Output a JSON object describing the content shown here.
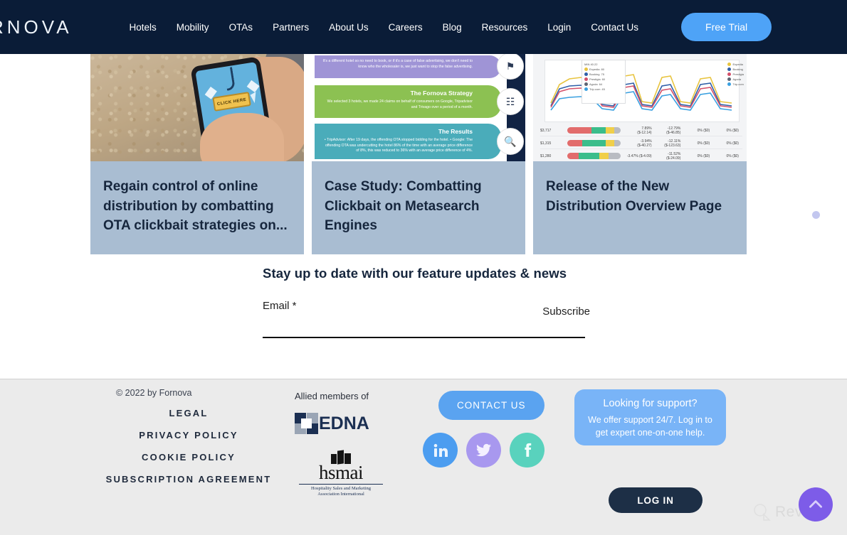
{
  "navbar": {
    "logo": "RNOVA",
    "links": [
      {
        "label": "Hotels"
      },
      {
        "label": "Mobility"
      },
      {
        "label": "OTAs"
      },
      {
        "label": "Partners"
      },
      {
        "label": "About Us"
      },
      {
        "label": "Careers"
      },
      {
        "label": "Blog"
      },
      {
        "label": "Resources"
      },
      {
        "label": "Login"
      },
      {
        "label": "Contact Us"
      }
    ],
    "cta": "Free Trial"
  },
  "cards": [
    {
      "title": "Regain control of online distribution by combatting OTA clickbait strategies on...",
      "image_alt": "hand-holding-phone-clickbait",
      "image_text": "CLICK HERE"
    },
    {
      "title": "Case Study: Combatting Clickbait on Metasearch Engines",
      "image_alt": "fornova-strategy-infographic",
      "bands": [
        {
          "heading": "",
          "body": "It's a different hotel so no need to book, or if it's a case of false advertising, we don't need to know who the wholesaler is, we just want to stop the false advertising.",
          "color": "#9f94d6"
        },
        {
          "heading": "The Fornova Strategy",
          "body": "We selected 3 hotels, we made 24 claims on behalf of consumers on Google, Tripadvisor and Trivago over a period of a month.",
          "color": "#8cc152"
        },
        {
          "heading": "The Results",
          "body": "• TripAdvisor: After 19 days, the offending OTA stopped bidding for the hotel. • Google: The offending OTA was undercutting the hotel 86% of the time with an average price difference of 8%, this was reduced to 36% with an average price difference of 4%.",
          "color": "#4aacba"
        }
      ]
    },
    {
      "title": "Release of the New Distribution Overview Page",
      "image_alt": "distribution-overview-dashboard",
      "chart_legend_title": "MIN 40.22",
      "legend": [
        {
          "name": "Expedia",
          "value": "80",
          "color": "#e8c43f"
        },
        {
          "name": "Booking",
          "value": "75",
          "color": "#2f5fa8"
        },
        {
          "name": "Prestigia",
          "value": "60",
          "color": "#d4516a"
        },
        {
          "name": "Agoda",
          "value": "64",
          "color": "#5d6472"
        },
        {
          "name": "Trip.com",
          "value": "45",
          "color": "#3aa0e0"
        }
      ],
      "rows": [
        {
          "price": "$3,717",
          "pct1": "7.89% ($-12.14)",
          "pct2": "-12.79% ($-46.85)",
          "pct3": "0% ($0)",
          "pct4": "0% ($0)"
        },
        {
          "price": "$1,315",
          "pct1": "-3.94% ($-40.27)",
          "pct2": "-12.11% ($-123.63)",
          "pct3": "0% ($0)",
          "pct4": "0% ($0)"
        },
        {
          "price": "$1,280",
          "pct1": "-3.47% ($-4.09)",
          "pct2": "-11.52% ($-24.09)",
          "pct3": "0% ($0)",
          "pct4": "0% ($0)"
        }
      ]
    }
  ],
  "newsletter": {
    "title": "Stay up to date with our feature updates & news",
    "email_label": "Email *",
    "email_value": "",
    "email_placeholder": "",
    "subscribe_label": "Subscribe"
  },
  "footer": {
    "copyright": "© 2022 by Fornova",
    "links": [
      {
        "label": "LEGAL"
      },
      {
        "label": "PRIVACY POLICY"
      },
      {
        "label": "COOKIE POLICY"
      },
      {
        "label": "SUBSCRIPTION AGREEMENT"
      }
    ],
    "allied_label": "Allied members of",
    "hedna_name": "EDNA",
    "hsmai_name": "hsmai",
    "hsmai_sub_line1": "Hospitality Sales and Marketing",
    "hsmai_sub_line2": "Association International",
    "contact_button": "CONTACT US",
    "social": [
      {
        "name": "linkedin-icon",
        "color": "#4c9df0"
      },
      {
        "name": "twitter-icon",
        "color": "#a898ef"
      },
      {
        "name": "facebook-icon",
        "color": "#59d2bd"
      }
    ],
    "support_title": "Looking for support?",
    "support_body": "We offer support 24/7. Log in to get expert one-on-one help.",
    "login_button": "LOG IN"
  },
  "overlay": {
    "watermark": "Revain"
  },
  "colors": {
    "nav_bg": "#0a1c37",
    "accent_blue": "#4ea3f7",
    "card_caption_bg": "#a9bdd2",
    "footer_bg": "#ebebeb",
    "support_bg": "#79b4f7",
    "login_bg": "#1d2f46",
    "scrolltop_bg": "#7d5ce8"
  }
}
